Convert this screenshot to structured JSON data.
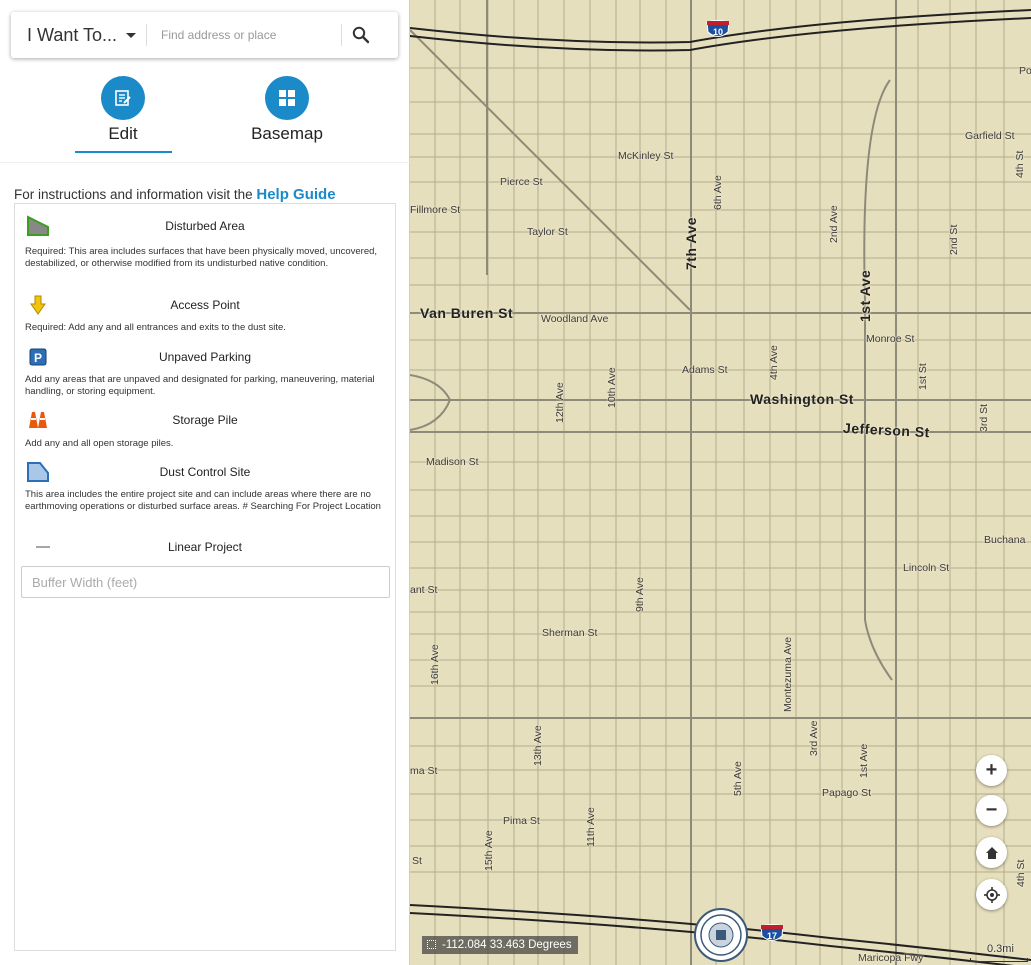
{
  "search": {
    "menu_label": "I Want To...",
    "placeholder": "Find address or place"
  },
  "tools": {
    "edit_label": "Edit",
    "basemap_label": "Basemap"
  },
  "help": {
    "prefix": "For instructions and information visit the",
    "link": "Help Guide"
  },
  "legend": [
    {
      "title": "Disturbed Area",
      "desc": "Required: This area includes surfaces that have been physically moved, uncovered, destabilized, or otherwise modified from its undisturbed native condition.",
      "icon": "disturbed-area-icon"
    },
    {
      "title": "Access Point",
      "desc": "Required: Add any and all entrances and exits to the dust site.",
      "icon": "access-point-icon"
    },
    {
      "title": "Unpaved Parking",
      "desc": "Add any areas that are unpaved and designated for parking, maneuvering, material handling, or storing equipment.",
      "icon": "parking-icon"
    },
    {
      "title": "Storage Pile",
      "desc": "Add any and all open storage piles.",
      "icon": "traffic-cone-icon"
    },
    {
      "title": "Dust Control Site",
      "desc": "This area includes the entire project site and can include areas where there are no earthmoving operations or disturbed surface areas. # Searching For Project Location",
      "icon": "dust-control-site-icon"
    },
    {
      "title": "Linear Project",
      "desc": "",
      "icon": "line-icon"
    }
  ],
  "buffer": {
    "placeholder": "Buffer Width (feet)"
  },
  "map": {
    "coordinates": "-112.084 33.463 Degrees",
    "scale": "0.3mi",
    "streets": {
      "van_buren": "Van Buren St",
      "washington": "Washington St",
      "jefferson": "Jefferson St",
      "seventh_ave": "7th Ave",
      "first_ave": "1st Ave",
      "mckinley": "McKinley St",
      "pierce": "Pierce St",
      "fillmore": "Fillmore St",
      "taylor": "Taylor St",
      "garfield": "Garfield St",
      "woodland": "Woodland Ave",
      "monroe": "Monroe St",
      "adams": "Adams St",
      "madison": "Madison St",
      "buchanan": "Buchana",
      "lincoln": "Lincoln St",
      "grant": "ant St",
      "sherman": "Sherman St",
      "papago": "Papago St",
      "pima": "Pima St",
      "yuma": "ma St",
      "s_st": "St",
      "maricopa_fwy": "Maricopa Fwy",
      "po": "Po",
      "sixth_ave": "6th Ave",
      "second_ave": "2nd Ave",
      "second_st": "2nd St",
      "fourth_st": "4th St",
      "fourth_ave": "4th Ave",
      "first_st": "1st St",
      "third_st": "3rd St",
      "twelfth_ave": "12th Ave",
      "tenth_ave": "10th Ave",
      "ninth_ave": "9th Ave",
      "sixteenth_ave": "16th Ave",
      "thirteenth_ave": "13th Ave",
      "eleventh_ave": "11th Ave",
      "fifteenth_ave": "15th Ave",
      "fifth_ave": "5th Ave",
      "third_ave": "3rd Ave",
      "first_ave_s": "1st Ave",
      "montezuma": "Montezuma Ave",
      "fourth_st_s": "4th St"
    },
    "shields": {
      "i10": "10",
      "i17": "17"
    }
  }
}
